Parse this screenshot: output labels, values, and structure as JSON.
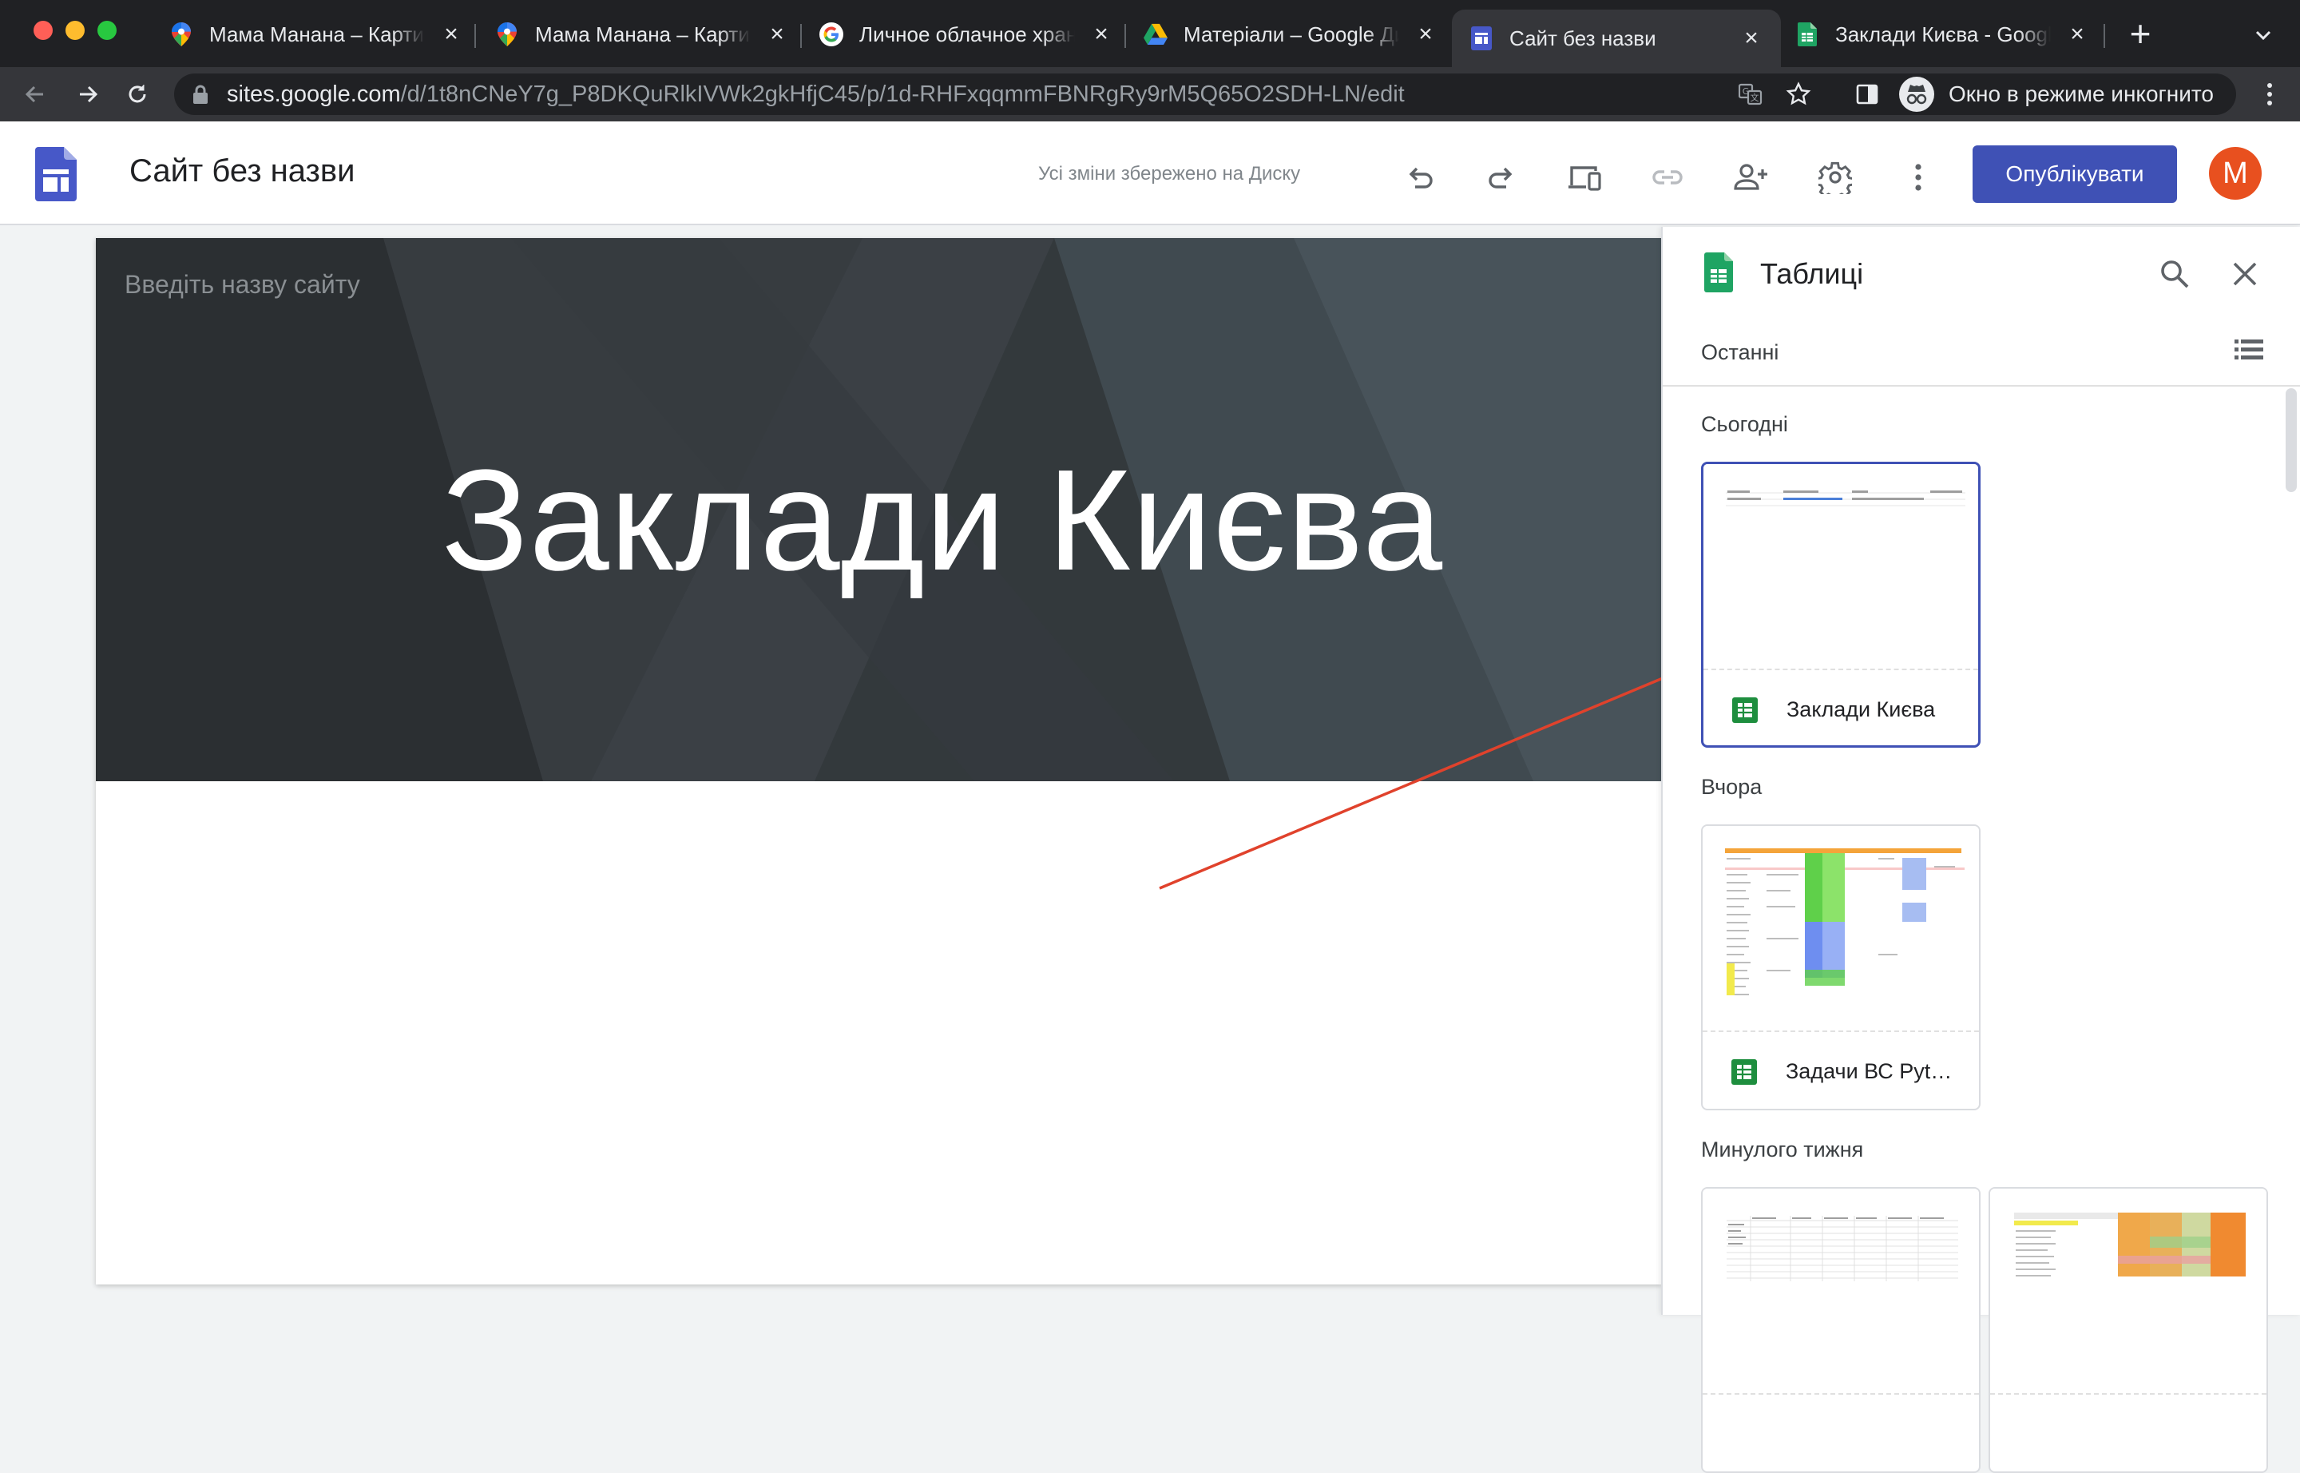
{
  "browser": {
    "tabs": [
      {
        "title": "Мама Манана – Карти Google",
        "favicon": "google-maps-icon",
        "active": false
      },
      {
        "title": "Мама Манана – Карти Google",
        "favicon": "google-maps-icon",
        "active": false
      },
      {
        "title": "Личное облачное хранилище",
        "favicon": "google-icon",
        "active": false
      },
      {
        "title": "Матеріали – Google Диск",
        "favicon": "google-drive-icon",
        "active": false
      },
      {
        "title": "Сайт без назви",
        "favicon": "google-sites-icon",
        "active": true
      },
      {
        "title": "Заклади Києва - Google Таблиці",
        "favicon": "google-sheets-icon",
        "active": false
      }
    ],
    "url_host": "sites.google.com",
    "url_path": "/d/1t8nCNeY7g_P8DKQuRlkIVWk2gkHfjC45/p/1d-RHFxqqmmFBNRgRy9rM5Q65O2SDH-LN/edit",
    "incognito_label": "Окно в режиме инкогнито"
  },
  "header": {
    "doc_title": "Сайт без назви",
    "save_status": "Усі зміни збережено на Диску",
    "publish_label": "Опублікувати",
    "avatar_letter": "M"
  },
  "page": {
    "site_name_placeholder": "Введіть назву сайту",
    "hero_title": "Заклади Києва"
  },
  "panel": {
    "title": "Таблиці",
    "recent_label": "Останні",
    "sections": [
      {
        "label": "Сьогодні",
        "files": [
          {
            "name": "Заклади Києва",
            "selected": true
          }
        ]
      },
      {
        "label": "Вчора",
        "files": [
          {
            "name": "Задачи ВС Python",
            "selected": false
          }
        ]
      },
      {
        "label": "Минулого тижня",
        "files": [
          {
            "name": "",
            "selected": false
          },
          {
            "name": "",
            "selected": false
          }
        ]
      }
    ]
  },
  "colors": {
    "accent": "#3f51b5",
    "avatar": "#e8501f",
    "sheets_green": "#1e8e3e",
    "hero_bg": "#33393c",
    "annotation_arrow": "#e0422c"
  }
}
